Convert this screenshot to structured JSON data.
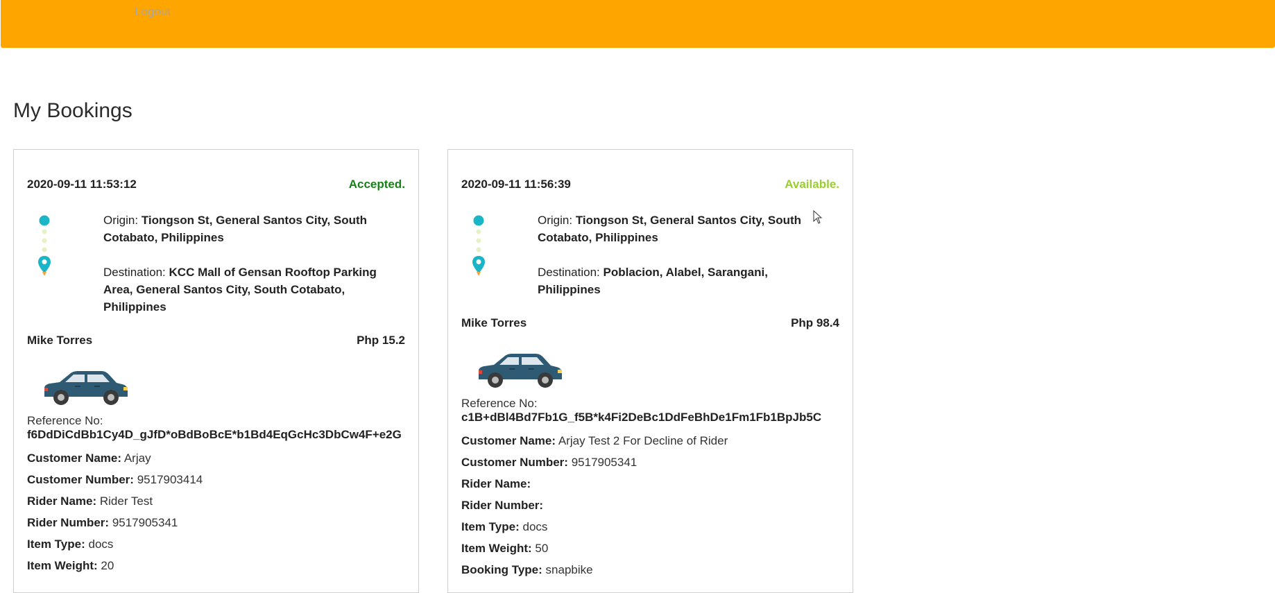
{
  "header": {
    "logout_label": "Logout",
    "bar_color": "#ffa500"
  },
  "page": {
    "title": "My Bookings"
  },
  "bookings": [
    {
      "date": "2020-09-11 11:53:12",
      "status": "Accepted.",
      "status_color": "#178117",
      "origin_label": "Origin:",
      "origin": "Tiongson St, General Santos City, South Cotabato, Philippines",
      "destination_label": "Destination:",
      "destination": "KCC Mall of Gensan Rooftop Parking Area, General Santos City, South Cotabato, Philippines",
      "rider_display": "Mike Torres",
      "price": "Php 15.2",
      "ref_label": "Reference No:",
      "ref_no": "f6DdDiCdBb1Cy4D_gJfD*oBdBoBcE*b1Bd4EqGcHc3DbCw4F+e2G",
      "fields": [
        {
          "key": "Customer Name:",
          "value": "Arjay"
        },
        {
          "key": "Customer Number:",
          "value": "9517903414"
        },
        {
          "key": "Rider Name:",
          "value": "Rider Test"
        },
        {
          "key": "Rider Number:",
          "value": "9517905341"
        },
        {
          "key": "Item Type:",
          "value": "docs"
        },
        {
          "key": "Item Weight:",
          "value": "20"
        }
      ]
    },
    {
      "date": "2020-09-11 11:56:39",
      "status": "Available.",
      "status_color": "#9acd32",
      "origin_label": "Origin:",
      "origin": "Tiongson St, General Santos City, South Cotabato, Philippines",
      "destination_label": "Destination:",
      "destination": "Poblacion, Alabel, Sarangani, Philippines",
      "rider_display": "Mike Torres",
      "price": "Php 98.4",
      "ref_label": "Reference No:",
      "ref_no": "c1B+dBl4Bd7Fb1G_f5B*k4Fi2DeBc1DdFeBhDe1Fm1Fb1BpJb5C",
      "fields": [
        {
          "key": "Customer Name:",
          "value": "Arjay Test 2 For Decline of Rider"
        },
        {
          "key": "Customer Number:",
          "value": "9517905341"
        },
        {
          "key": "Rider Name:",
          "value": ""
        },
        {
          "key": "Rider Number:",
          "value": ""
        },
        {
          "key": "Item Type:",
          "value": "docs"
        },
        {
          "key": "Item Weight:",
          "value": "50"
        },
        {
          "key": "Booking Type:",
          "value": "snapbike"
        }
      ]
    }
  ],
  "icons": {
    "route": "route-pin-icon",
    "vehicle": "car-icon",
    "pointer": "mouse-cursor-icon"
  }
}
